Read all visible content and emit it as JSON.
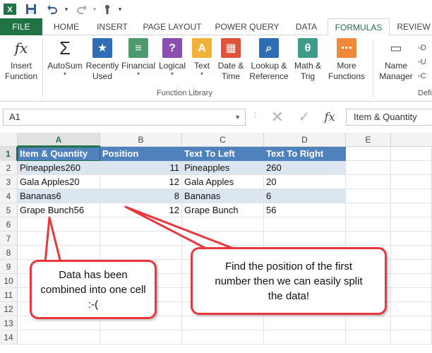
{
  "tabs": [
    "FILE",
    "HOME",
    "INSERT",
    "PAGE LAYOUT",
    "POWER QUERY",
    "DATA",
    "FORMULAS",
    "REVIEW"
  ],
  "active_tab": "FORMULAS",
  "ribbon": {
    "insert_function": {
      "line1": "Insert",
      "line2": "Function"
    },
    "autosum": {
      "line1": "AutoSum"
    },
    "recently_used": {
      "line1": "Recently",
      "line2": "Used"
    },
    "financial": {
      "line1": "Financial"
    },
    "logical": {
      "line1": "Logical"
    },
    "text": {
      "line1": "Text"
    },
    "date_time": {
      "line1": "Date &",
      "line2": "Time"
    },
    "lookup": {
      "line1": "Lookup &",
      "line2": "Reference"
    },
    "math": {
      "line1": "Math &",
      "line2": "Trig"
    },
    "more": {
      "line1": "More",
      "line2": "Functions"
    },
    "name_manager": {
      "line1": "Name",
      "line2": "Manager"
    },
    "group_label": "Function Library",
    "defined_label": "Defi"
  },
  "formula_bar": {
    "name_box": "A1",
    "fx": "fx",
    "content": "Item & Quantity"
  },
  "columns": [
    "A",
    "B",
    "C",
    "D",
    "E"
  ],
  "rows": [
    "1",
    "2",
    "3",
    "4",
    "5",
    "6",
    "7",
    "8",
    "9",
    "10",
    "11",
    "12",
    "13",
    "14"
  ],
  "table": {
    "headers": [
      "Item & Quantity",
      "Position",
      "Text To Left",
      "Text To Right"
    ],
    "rows": [
      [
        "Pineapples260",
        "11",
        "Pineapples",
        "260"
      ],
      [
        "Gala Apples20",
        "12",
        "Gala Apples",
        "20"
      ],
      [
        "Bananas6",
        "8",
        "Bananas",
        "6"
      ],
      [
        "Grape Bunch56",
        "12",
        "Grape Bunch",
        "56"
      ]
    ]
  },
  "callouts": {
    "left": "Data has been combined into one cell :-(",
    "right": "Find the position of the first number then we can easily split the data!"
  },
  "colors": {
    "excel_green": "#217346",
    "table_header": "#4f81bd",
    "band": "#dce6f1",
    "callout_border": "#e8383d"
  }
}
